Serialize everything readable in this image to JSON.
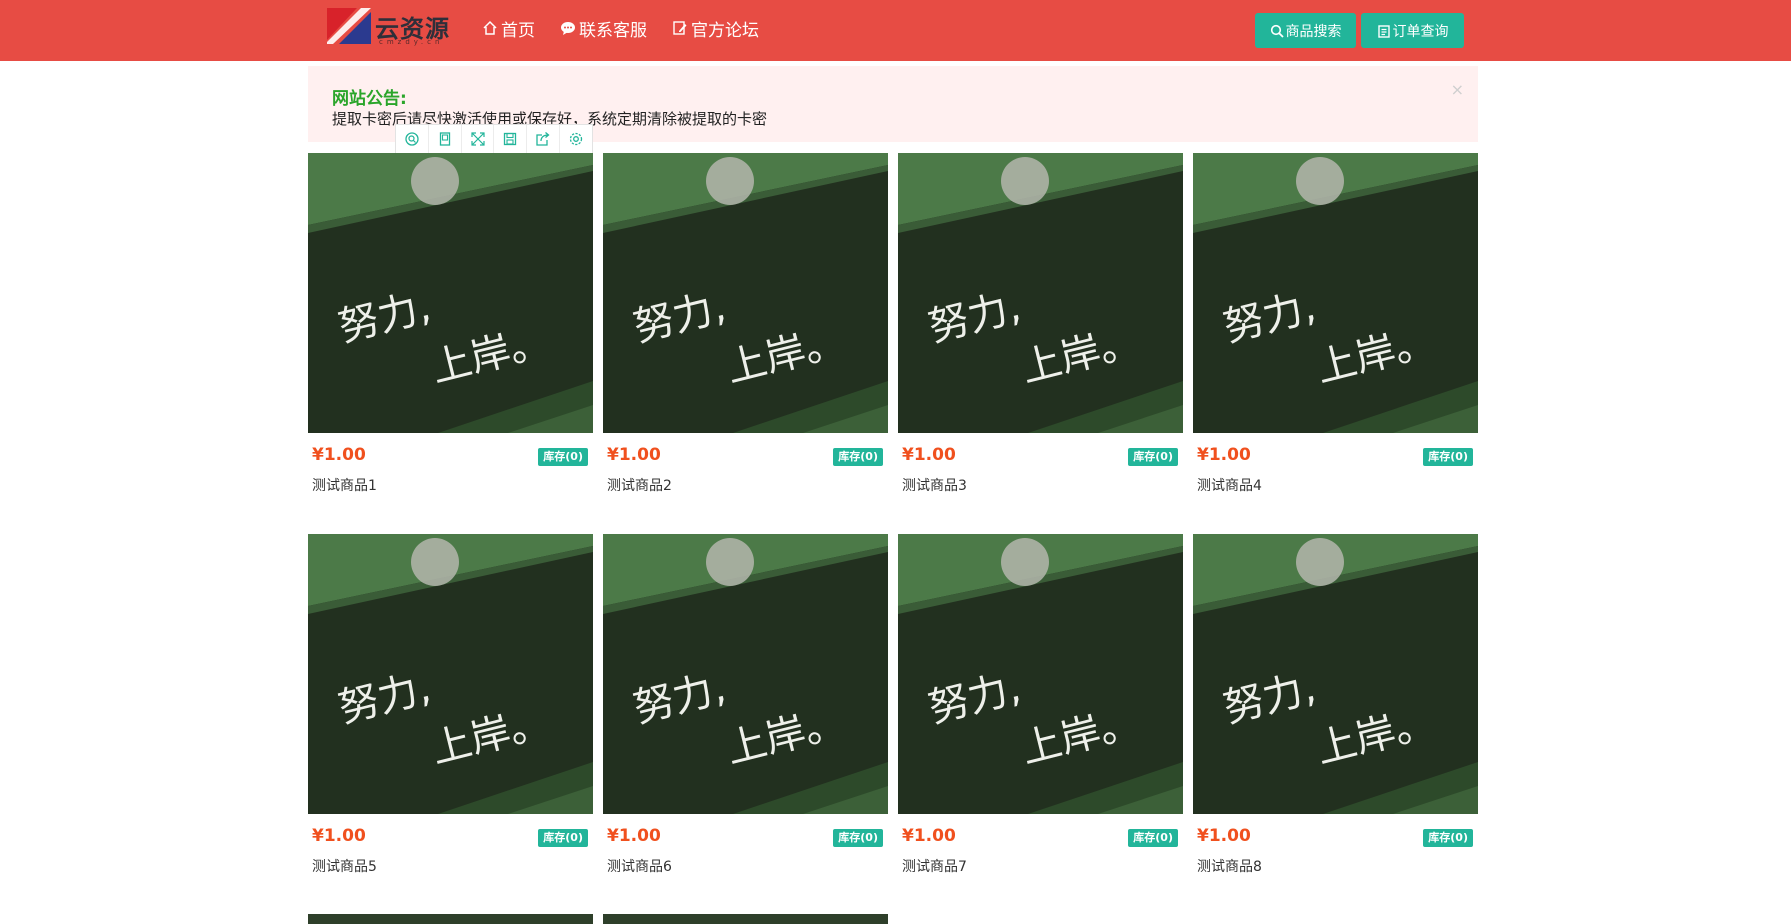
{
  "header": {
    "logo_text": "云资源",
    "logo_sub": "cmzdy.cn",
    "nav": [
      {
        "label": "首页",
        "icon": "home-icon"
      },
      {
        "label": "联系客服",
        "icon": "chat-icon"
      },
      {
        "label": "官方论坛",
        "icon": "forum-edit-icon"
      }
    ],
    "search_button": "商品搜索",
    "order_button": "订单查询"
  },
  "notice": {
    "title": "网站公告:",
    "text": "提取卡密后请尽快激活使用或保存好，系统定期清除被提取的卡密",
    "close": "×"
  },
  "toolbar_icons": [
    "search-image-icon",
    "bookmark-icon",
    "fullscreen-icon",
    "save-icon",
    "share-icon",
    "settings-icon"
  ],
  "products": [
    {
      "name": "测试商品1",
      "price": "¥1.00",
      "stock": "库存(0)",
      "image_text_1": "努力,",
      "image_text_2": "上岸。"
    },
    {
      "name": "测试商品2",
      "price": "¥1.00",
      "stock": "库存(0)",
      "image_text_1": "努力,",
      "image_text_2": "上岸。"
    },
    {
      "name": "测试商品3",
      "price": "¥1.00",
      "stock": "库存(0)",
      "image_text_1": "努力,",
      "image_text_2": "上岸。"
    },
    {
      "name": "测试商品4",
      "price": "¥1.00",
      "stock": "库存(0)",
      "image_text_1": "努力,",
      "image_text_2": "上岸。"
    },
    {
      "name": "测试商品5",
      "price": "¥1.00",
      "stock": "库存(0)",
      "image_text_1": "努力,",
      "image_text_2": "上岸。"
    },
    {
      "name": "测试商品6",
      "price": "¥1.00",
      "stock": "库存(0)",
      "image_text_1": "努力,",
      "image_text_2": "上岸。"
    },
    {
      "name": "测试商品7",
      "price": "¥1.00",
      "stock": "库存(0)",
      "image_text_1": "努力,",
      "image_text_2": "上岸。"
    },
    {
      "name": "测试商品8",
      "price": "¥1.00",
      "stock": "库存(0)",
      "image_text_1": "努力,",
      "image_text_2": "上岸。"
    }
  ],
  "colors": {
    "header": "#e74c44",
    "accent": "#22b59a",
    "price": "#f0501e",
    "notice_bg": "#fff0f0",
    "notice_title": "#2aa52a"
  }
}
